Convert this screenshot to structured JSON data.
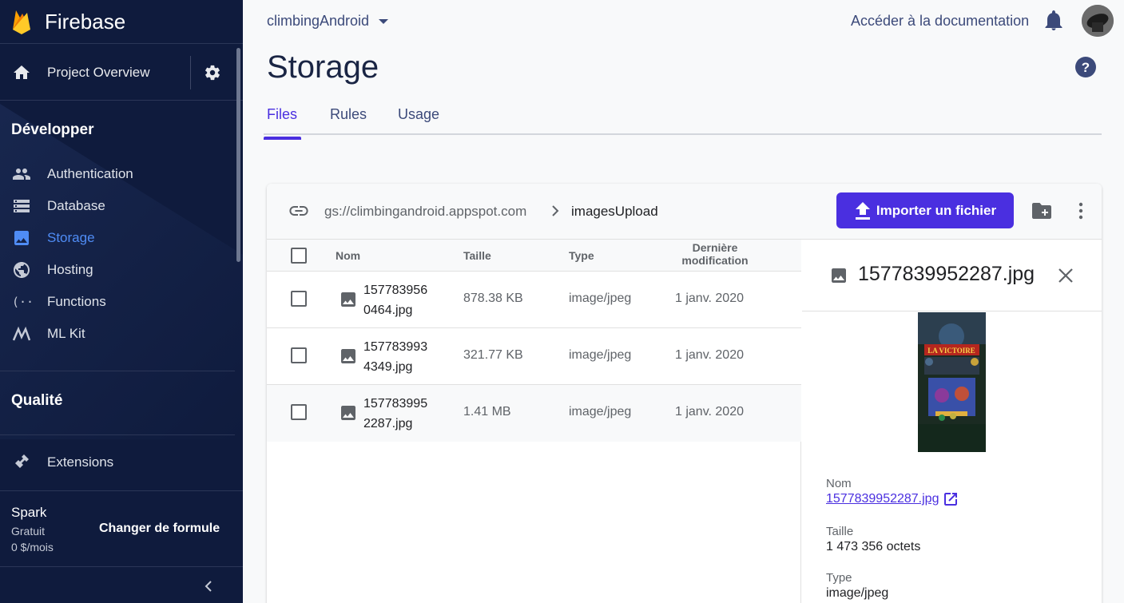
{
  "app": {
    "name": "Firebase"
  },
  "sidebar": {
    "overview_label": "Project Overview",
    "develop_title": "Développer",
    "develop_items": [
      {
        "label": "Authentication",
        "icon": "people-icon"
      },
      {
        "label": "Database",
        "icon": "database-icon"
      },
      {
        "label": "Storage",
        "icon": "storage-icon"
      },
      {
        "label": "Hosting",
        "icon": "globe-icon"
      },
      {
        "label": "Functions",
        "icon": "functions-icon"
      },
      {
        "label": "ML Kit",
        "icon": "mlkit-icon"
      }
    ],
    "quality_title": "Qualité",
    "extensions_label": "Extensions",
    "plan": {
      "name": "Spark",
      "tier": "Gratuit",
      "price": "0 $/mois",
      "change_label": "Changer de formule"
    }
  },
  "header": {
    "project": "climbingAndroid",
    "docs_link": "Accéder à la documentation",
    "page_title": "Storage"
  },
  "tabs": [
    {
      "label": "Files",
      "active": true
    },
    {
      "label": "Rules",
      "active": false
    },
    {
      "label": "Usage",
      "active": false
    }
  ],
  "browser": {
    "bucket": "gs://climbingandroid.appspot.com",
    "folder": "imagesUpload",
    "upload_label": "Importer un fichier",
    "columns": {
      "name": "Nom",
      "size": "Taille",
      "type": "Type",
      "modified_l1": "Dernière",
      "modified_l2": "modification"
    },
    "rows": [
      {
        "name_l1": "157783956",
        "name_l2": "0464.jpg",
        "size": "878.38 KB",
        "type": "image/jpeg",
        "modified": "1 janv. 2020"
      },
      {
        "name_l1": "157783993",
        "name_l2": "4349.jpg",
        "size": "321.77 KB",
        "type": "image/jpeg",
        "modified": "1 janv. 2020"
      },
      {
        "name_l1": "157783995",
        "name_l2": "2287.jpg",
        "size": "1.41 MB",
        "type": "image/jpeg",
        "modified": "1 janv. 2020"
      }
    ]
  },
  "detail": {
    "title": "1577839952287.jpg",
    "name_label": "Nom",
    "name_value": "1577839952287.jpg",
    "size_label": "Taille",
    "size_value": "1 473 356 octets",
    "type_label": "Type",
    "type_value": "image/jpeg",
    "thumb_text": "LA VICTOIRE"
  },
  "colors": {
    "accent": "#4a2fe0",
    "sidebar_bg": "#0f1b3d",
    "active_nav": "#4f8cf5"
  }
}
